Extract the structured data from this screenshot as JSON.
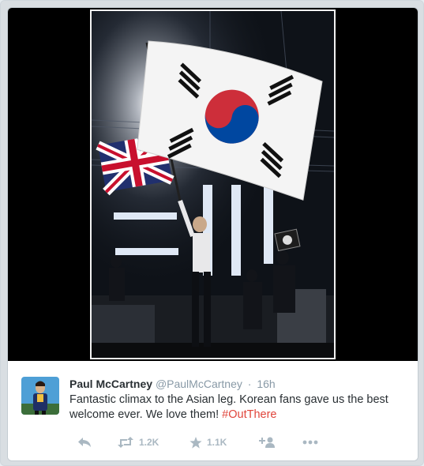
{
  "tweet": {
    "display_name": "Paul McCartney",
    "handle": "@PaulMcCartney",
    "separator": "·",
    "time": "16h",
    "text_main": "Fantastic climax to the Asian leg. Korean fans gave us the best welcome ever. We love them! ",
    "hashtag": "#OutThere"
  },
  "actions": {
    "reply_icon": "reply-icon",
    "retweet_icon": "retweet-icon",
    "retweet_count": "1.2K",
    "favorite_icon": "star-icon",
    "favorite_count": "1.1K",
    "follow_icon": "follow-icon",
    "more_icon": "more-icon"
  },
  "colors": {
    "hashtag": "#e0453b",
    "meta": "#8899a6",
    "action_icons": "#aab8c2"
  }
}
